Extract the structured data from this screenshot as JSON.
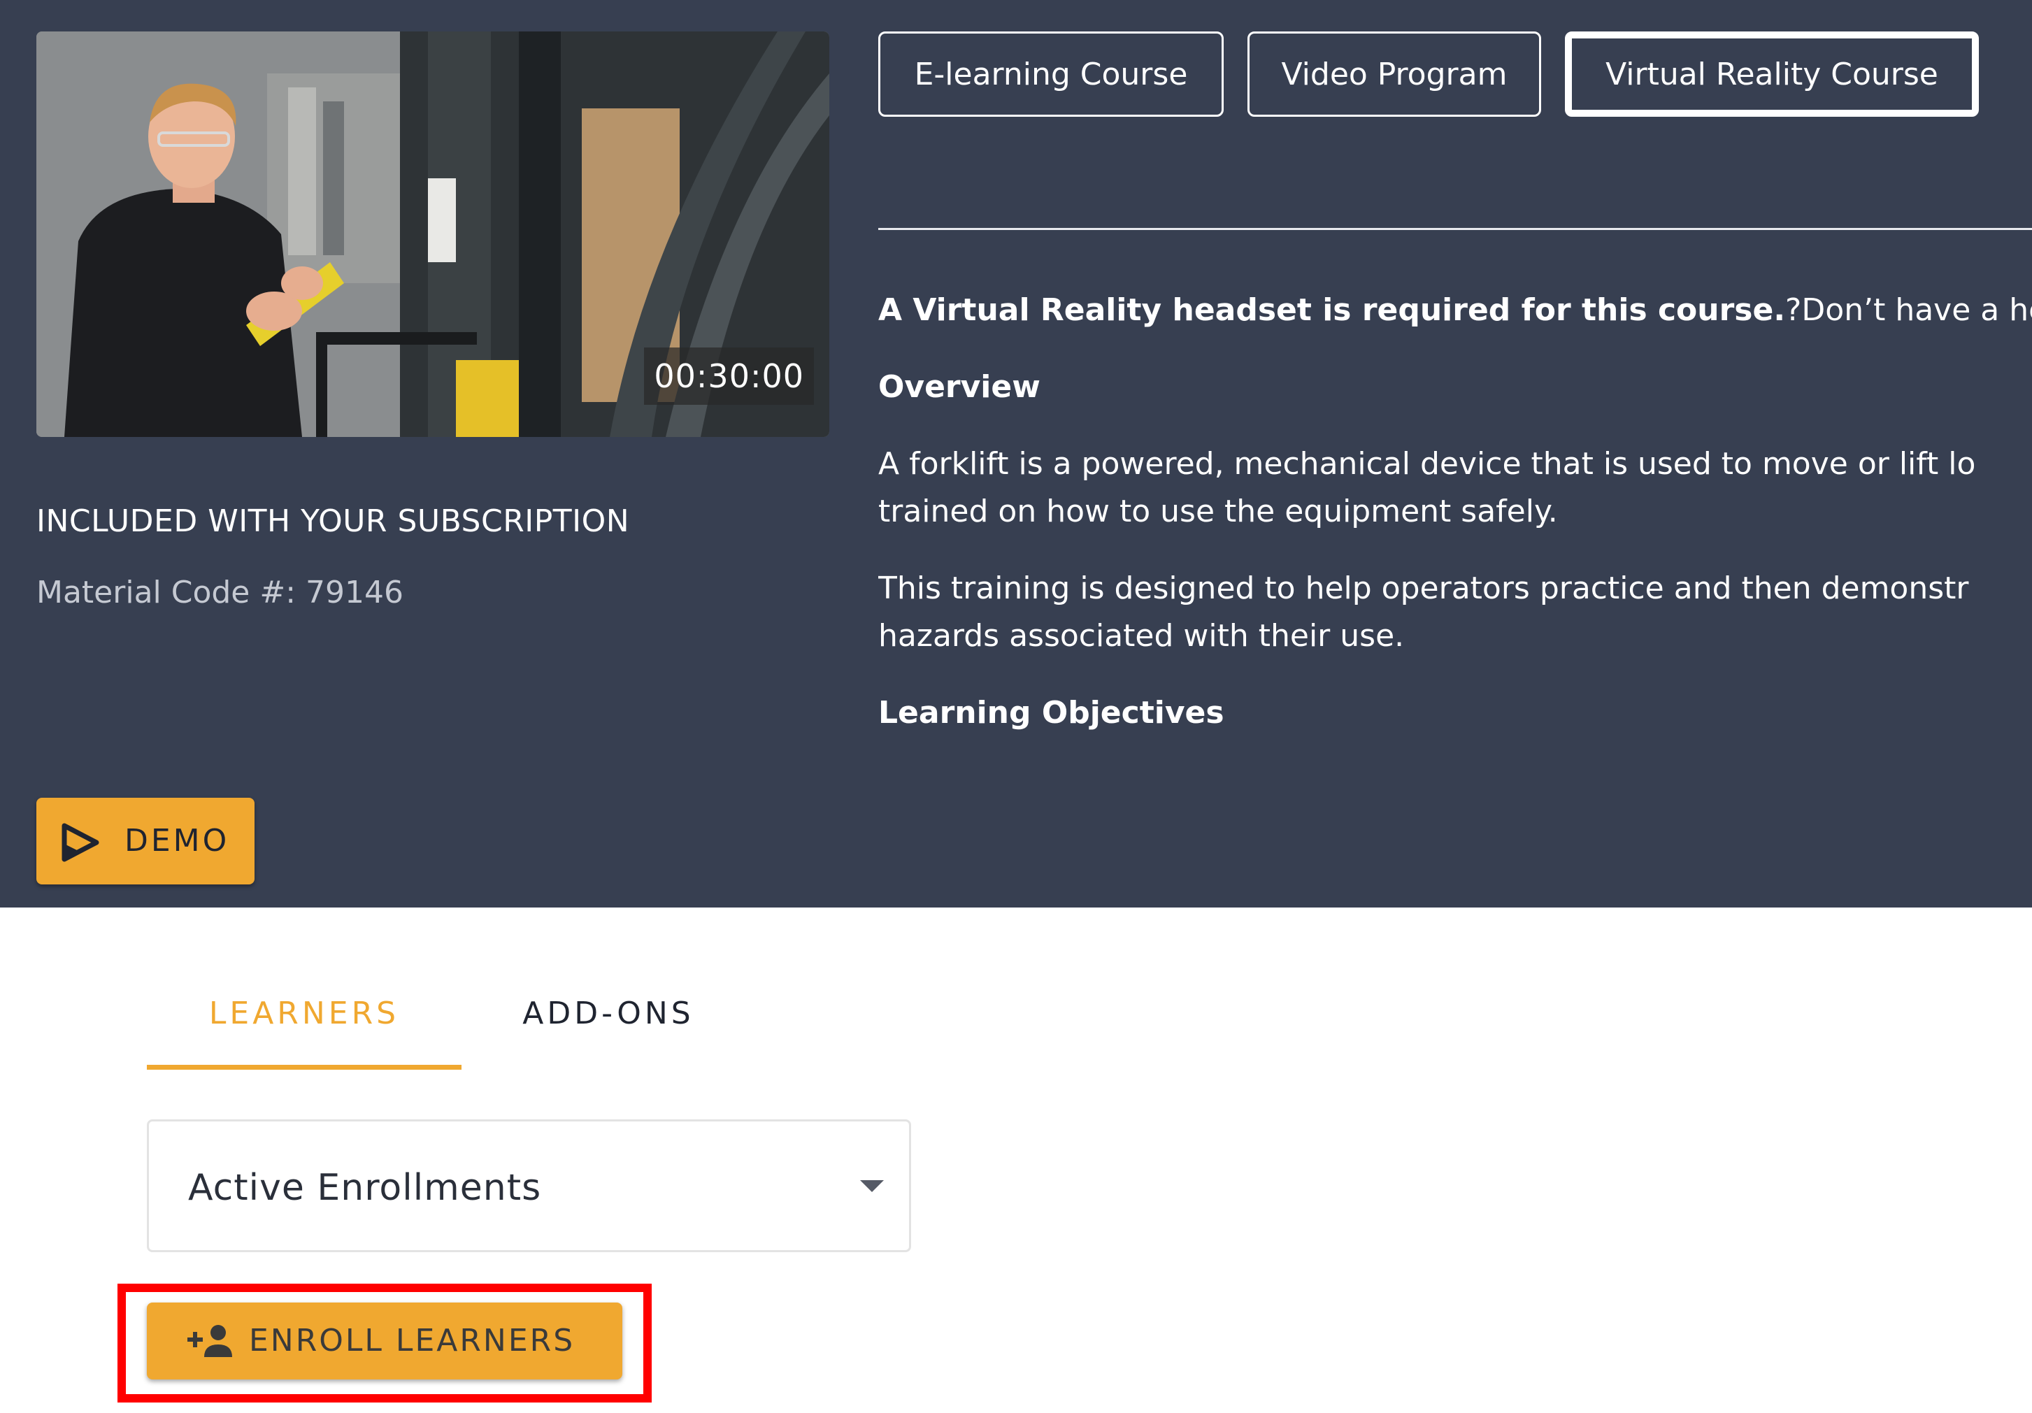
{
  "thumbnail": {
    "duration": "00:30:00"
  },
  "subscription": {
    "included_text": "INCLUDED WITH YOUR SUBSCRIPTION",
    "material_code": "Material Code #: 79146"
  },
  "demo": {
    "label": "DEMO"
  },
  "format_tabs": [
    {
      "label": "E-learning Course",
      "active": false
    },
    {
      "label": "Video Program",
      "active": false
    },
    {
      "label": "Virtual Reality Course",
      "active": true
    }
  ],
  "description": {
    "headset_note_bold": "A Virtual Reality headset is required for this course.",
    "headset_note_rest": "?Don’t have a he",
    "overview_heading": "Overview",
    "overview_line1": "A forklift is a powered, mechanical device that is used to move or lift lo",
    "overview_line2": "trained on how to use the equipment safely.",
    "training_line1": "This training is designed to help operators practice and then demonstr",
    "training_line2": "hazards associated with their use.",
    "objectives_heading": "Learning Objectives"
  },
  "tabs": {
    "learners": "LEARNERS",
    "addons": "ADD-ONS"
  },
  "enrollment_filter": {
    "selected": "Active Enrollments"
  },
  "enroll": {
    "label": "ENROLL LEARNERS"
  },
  "colors": {
    "hero_bg": "#373f51",
    "accent": "#f0a830",
    "highlight": "#ff0000"
  }
}
